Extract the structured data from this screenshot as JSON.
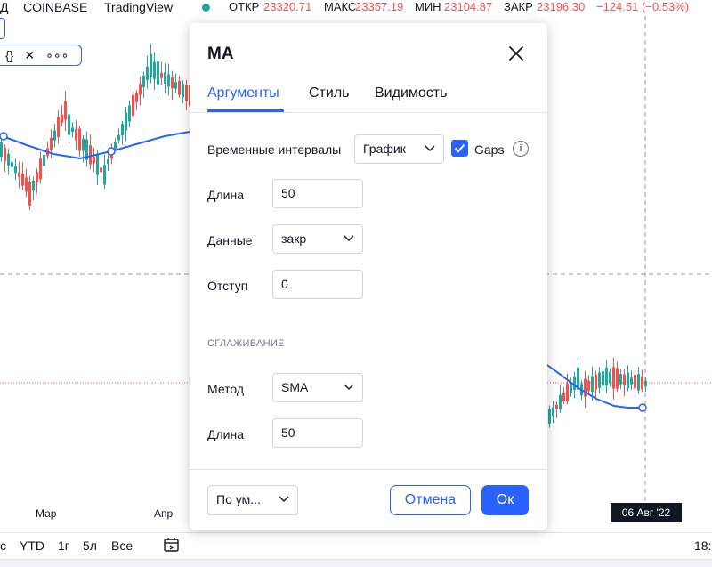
{
  "header": {
    "prefix": "Д",
    "exchange": "COINBASE",
    "platform": "TradingView",
    "open_label": "ОТКР",
    "open_value": "23320.71",
    "high_label": "МАКС",
    "high_value": "23357.19",
    "low_label": "МИН",
    "low_value": "23104.87",
    "close_label": "ЗАКР",
    "close_value": "23196.30",
    "change_value": "−124.51 (−0.53%)"
  },
  "drawing_toolbar": {
    "code": "{}",
    "remove": "✕",
    "more": "∘∘∘"
  },
  "chart": {
    "x_labels": [
      "Мар",
      "Апр"
    ],
    "crosshair_date": "06 Авг '22",
    "colors": {
      "up": "#26a69a",
      "down": "#ef5350",
      "ma": "#2962ff"
    }
  },
  "bottom_bar": {
    "partial_left": "с",
    "ranges": [
      "YTD",
      "1г",
      "5л",
      "Все"
    ],
    "partial_right": "18:"
  },
  "dialog": {
    "title": "MA",
    "tabs": [
      "Аргументы",
      "Стиль",
      "Видимость"
    ],
    "active_tab": "Аргументы",
    "timeframe_label": "Временные интервалы",
    "timeframe_value": "График",
    "gaps_label": "Gaps",
    "gaps_checked": true,
    "length_label": "Длина",
    "length_value": "50",
    "source_label": "Данные",
    "source_value": "закр",
    "offset_label": "Отступ",
    "offset_value": "0",
    "smoothing_title": "СГЛАЖИВАНИЕ",
    "method_label": "Метод",
    "method_value": "SMA",
    "smooth_length_label": "Длина",
    "smooth_length_value": "50",
    "defaults_label": "По ум...",
    "cancel_label": "Отмена",
    "ok_label": "Ок"
  }
}
